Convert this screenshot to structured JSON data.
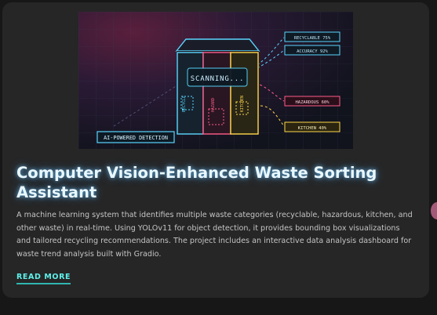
{
  "hero": {
    "scanning_label": "SCANNING...",
    "badge_label": "AI-POWERED DETECTION",
    "bin_labels": [
      "RECYCLE",
      "HAZARD",
      "KITCHEN"
    ],
    "callouts": [
      {
        "label": "RECYCLABLE 75%",
        "color": "#5ad6ff"
      },
      {
        "label": "ACCURACY 92%",
        "color": "#5ad6ff"
      },
      {
        "label": "HAZARDOUS 60%",
        "color": "#ff5c8a"
      },
      {
        "label": "KITCHEN 40%",
        "color": "#ffd84a"
      }
    ]
  },
  "card": {
    "title": "Computer Vision-Enhanced Waste Sorting Assistant",
    "description": "A machine learning system that identifies multiple waste categories (recyclable, hazardous, kitchen, and other waste) in real-time. Using YOLOv11 for object detection, it provides bounding box visualizations and tailored recycling recommendations. The project includes an interactive data analysis dashboard for waste trend analysis built with Gradio.",
    "read_more": "READ MORE"
  },
  "colors": {
    "accent": "#5ff0ea",
    "recyclable": "#5ad6ff",
    "hazardous": "#ff5c8a",
    "kitchen": "#ffd84a"
  }
}
